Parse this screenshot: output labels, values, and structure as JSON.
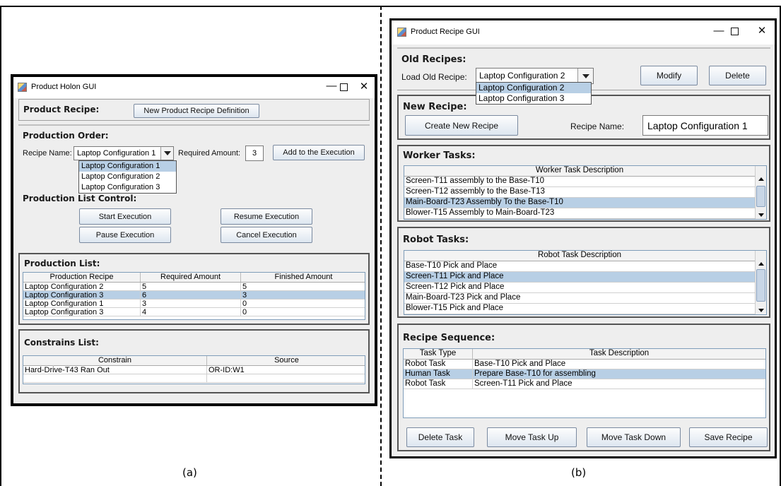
{
  "captions": {
    "left": "(a)",
    "right": "(b)"
  },
  "holon": {
    "title": "Product Holon GUI",
    "window_controls": {
      "minimize": "—",
      "maximize": "□",
      "close": "✕"
    },
    "recipe": {
      "title": "Product Recipe:",
      "new_button": "New Product Recipe Definition"
    },
    "order": {
      "title": "Production Order:",
      "recipe_label": "Recipe Name:",
      "recipe_value": "Laptop Configuration 1",
      "recipe_options": [
        "Laptop Configuration 1",
        "Laptop Configuration 2",
        "Laptop Configuration 3"
      ],
      "amount_label": "Required Amount:",
      "amount_value": "3",
      "add_button": "Add to the Execution"
    },
    "control": {
      "title": "Production List Control:",
      "start": "Start Execution",
      "resume": "Resume Execution",
      "pause": "Pause Execution",
      "cancel": "Cancel Execution"
    },
    "list": {
      "title": "Production List:",
      "headers": [
        "Production Recipe",
        "Required Amount",
        "Finished Amount"
      ],
      "rows": [
        [
          "Laptop Configuration 2",
          "5",
          "5"
        ],
        [
          "Laptop Configuration 3",
          "6",
          "3"
        ],
        [
          "Laptop Configuration 1",
          "3",
          "0"
        ],
        [
          "Laptop Configuration 3",
          "4",
          "0"
        ]
      ]
    },
    "constraints": {
      "title": "Constrains List:",
      "headers": [
        "Constrain",
        "Source"
      ],
      "rows": [
        [
          "Hard-Drive-T43 Ran Out",
          "OR-ID:W1"
        ]
      ]
    }
  },
  "recipe_gui": {
    "title": "Product Recipe GUI",
    "window_controls": {
      "minimize": "—",
      "maximize": "□",
      "close": "✕"
    },
    "old": {
      "title": "Old Recipes:",
      "load_label": "Load Old Recipe:",
      "load_value": "Laptop Configuration 2",
      "options": [
        "Laptop Configuration 2",
        "Laptop Configuration 3"
      ],
      "modify": "Modify",
      "delete": "Delete"
    },
    "new": {
      "title": "New Recipe:",
      "create": "Create New Recipe",
      "name_label": "Recipe Name:",
      "name_value": "Laptop Configuration 1"
    },
    "worker": {
      "title": "Worker Tasks:",
      "header": "Worker Task Description",
      "rows": [
        "Screen-T11 assembly to the Base-T10",
        "Screen-T12 assembly to the Base-T13",
        "Main-Board-T23 Assembly To the Base-T10",
        "Blower-T15 Assembly to Main-Board-T23"
      ]
    },
    "robot": {
      "title": "Robot Tasks:",
      "header": "Robot Task Description",
      "rows": [
        "Base-T10 Pick and Place",
        "Screen-T11 Pick and Place",
        "Screen-T12 Pick and Place",
        "Main-Board-T23 Pick and Place",
        "Blower-T15 Pick and Place"
      ]
    },
    "sequence": {
      "title": "Recipe Sequence:",
      "headers": [
        "Task Type",
        "Task Description"
      ],
      "rows": [
        [
          "Robot Task",
          "Base-T10 Pick and Place"
        ],
        [
          "Human Task",
          "Prepare Base-T10 for assembling"
        ],
        [
          "Robot Task",
          "Screen-T11 Pick and Place"
        ]
      ],
      "delete": "Delete Task",
      "up": "Move Task Up",
      "down": "Move Task Down",
      "save": "Save Recipe"
    }
  }
}
